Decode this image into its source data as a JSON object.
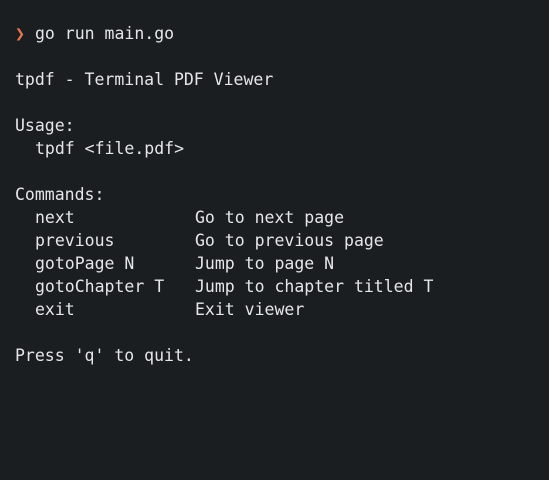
{
  "terminal": {
    "prompt_symbol": "❯",
    "command": "go run main.go",
    "title_line": "tpdf - Terminal PDF Viewer",
    "usage_header": "Usage:",
    "usage_line": "tpdf <file.pdf>",
    "commands_header": "Commands:",
    "commands": [
      {
        "name": "next",
        "description": "Go to next page"
      },
      {
        "name": "previous",
        "description": "Go to previous page"
      },
      {
        "name": "gotoPage N",
        "description": "Jump to page N"
      },
      {
        "name": "gotoChapter T",
        "description": "Jump to chapter titled T"
      },
      {
        "name": "exit",
        "description": "Exit viewer"
      }
    ],
    "quit_hint": "Press 'q' to quit."
  },
  "colors": {
    "background": "#1b1e20",
    "foreground": "#e4e6e8",
    "prompt": "#e8764f"
  }
}
